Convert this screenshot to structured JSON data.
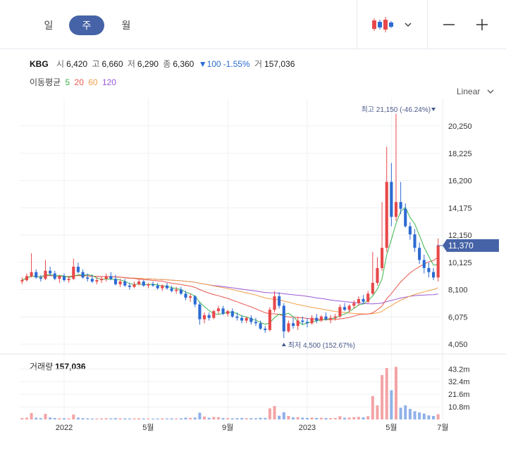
{
  "tabs": [
    {
      "label": "일",
      "active": false
    },
    {
      "label": "주",
      "active": true
    },
    {
      "label": "월",
      "active": false
    }
  ],
  "toolbar": {
    "chart_type_icon": "candlestick-icon",
    "zoom_out_icon": "minus-icon",
    "zoom_in_icon": "plus-icon"
  },
  "info": {
    "symbol": "KBG",
    "open_label": "시",
    "open": "6,420",
    "high_label": "고",
    "high": "6,660",
    "low_label": "저",
    "low": "6,290",
    "close_label": "종",
    "close": "6,360",
    "change": "▼100",
    "change_pct": "-1.55%",
    "volume_label": "거",
    "volume": "157,036"
  },
  "ma": {
    "label": "이동평균",
    "periods": [
      {
        "period": "5",
        "color": "#3cb44b"
      },
      {
        "period": "20",
        "color": "#e8584f"
      },
      {
        "period": "60",
        "color": "#f0a04b"
      },
      {
        "period": "120",
        "color": "#9b59d6"
      }
    ]
  },
  "scale": {
    "label": "Linear"
  },
  "colors": {
    "up": "#e8484a",
    "down": "#2c6bd3",
    "tab_active": "#4663a7",
    "grid": "#eef0f3",
    "last_price_bg": "#4663a7",
    "volume_up": "#f4a3a5",
    "volume_down": "#8fb1e9"
  },
  "chart_data": {
    "type": "candlestick",
    "x_labels": [
      "2022",
      "5월",
      "9월",
      "2023",
      "5월",
      "7월"
    ],
    "x_label_index": [
      9,
      27,
      44,
      61,
      79,
      90
    ],
    "y_ticks": [
      "20,250",
      "18,225",
      "16,200",
      "14,175",
      "12,150",
      "10,125",
      "8,100",
      "6,075",
      "4,050"
    ],
    "y_tick_values": [
      20250,
      18225,
      16200,
      14175,
      12150,
      10125,
      8100,
      6075,
      4050
    ],
    "ylim": [
      4050,
      21300
    ],
    "last_price": "11,370",
    "last_price_value": 11370,
    "high_annotation": "최고 21,150 (-46.24%)",
    "high_index": 88,
    "high_value": 21150,
    "low_annotation": "최저 4,500 (152.67%)",
    "low_index": 56,
    "low_value": 4500,
    "candles": [
      [
        8700,
        9000,
        8500,
        8800
      ],
      [
        8800,
        9300,
        8700,
        9100
      ],
      [
        9100,
        10800,
        9000,
        9400
      ],
      [
        9400,
        9600,
        8900,
        9000
      ],
      [
        9000,
        9200,
        8700,
        8900
      ],
      [
        8900,
        10300,
        8800,
        9500
      ],
      [
        9500,
        9800,
        9100,
        9300
      ],
      [
        9300,
        9500,
        8800,
        8900
      ],
      [
        8900,
        9200,
        8600,
        9100
      ],
      [
        9100,
        9300,
        8700,
        8800
      ],
      [
        8800,
        9100,
        8600,
        8900
      ],
      [
        8900,
        10400,
        8800,
        9800
      ],
      [
        9800,
        10100,
        9300,
        9400
      ],
      [
        9400,
        9600,
        8900,
        9000
      ],
      [
        9000,
        9300,
        8700,
        8900
      ],
      [
        8900,
        9200,
        8600,
        8700
      ],
      [
        8700,
        9000,
        8500,
        8800
      ],
      [
        8800,
        9100,
        8600,
        8900
      ],
      [
        8900,
        9300,
        8700,
        9100
      ],
      [
        9100,
        9400,
        8800,
        8900
      ],
      [
        8900,
        9200,
        8400,
        8500
      ],
      [
        8500,
        8900,
        8300,
        8700
      ],
      [
        8700,
        8900,
        8300,
        8400
      ],
      [
        8400,
        8600,
        8100,
        8300
      ],
      [
        8300,
        8700,
        8200,
        8500
      ],
      [
        8500,
        8900,
        8400,
        8700
      ],
      [
        8700,
        8800,
        8300,
        8400
      ],
      [
        8400,
        8600,
        8200,
        8500
      ],
      [
        8500,
        8700,
        8300,
        8400
      ],
      [
        8400,
        8600,
        8100,
        8200
      ],
      [
        8200,
        8500,
        8000,
        8400
      ],
      [
        8400,
        8600,
        8100,
        8200
      ],
      [
        8200,
        8400,
        7900,
        8000
      ],
      [
        8000,
        8300,
        7800,
        8100
      ],
      [
        8100,
        8300,
        7700,
        7800
      ],
      [
        7800,
        8000,
        7300,
        7500
      ],
      [
        7500,
        7800,
        7200,
        7600
      ],
      [
        7600,
        7700,
        6800,
        7000
      ],
      [
        7000,
        7200,
        5500,
        5900
      ],
      [
        5900,
        6400,
        5600,
        6200
      ],
      [
        6200,
        6400,
        5800,
        6000
      ],
      [
        6000,
        6600,
        5900,
        6500
      ],
      [
        6500,
        6900,
        6300,
        6700
      ],
      [
        6700,
        6900,
        6200,
        6300
      ],
      [
        6300,
        6600,
        6100,
        6500
      ],
      [
        6500,
        6700,
        6000,
        6100
      ],
      [
        6100,
        6400,
        5800,
        6000
      ],
      [
        6000,
        6200,
        5600,
        5800
      ],
      [
        5800,
        6100,
        5600,
        6000
      ],
      [
        6000,
        6200,
        5500,
        5700
      ],
      [
        5700,
        6000,
        5400,
        5600
      ],
      [
        5600,
        5800,
        5100,
        5200
      ],
      [
        5200,
        5400,
        4900,
        5100
      ],
      [
        5100,
        6800,
        5000,
        6600
      ],
      [
        6600,
        8000,
        6400,
        7600
      ],
      [
        7600,
        7900,
        6700,
        6900
      ],
      [
        6900,
        7100,
        4500,
        5000
      ],
      [
        5000,
        5800,
        4900,
        5600
      ],
      [
        5600,
        6000,
        5200,
        5400
      ],
      [
        5400,
        6100,
        5100,
        5800
      ],
      [
        5800,
        6100,
        5500,
        5700
      ],
      [
        5700,
        6000,
        5300,
        5600
      ],
      [
        5600,
        6200,
        5500,
        6000
      ],
      [
        6000,
        6300,
        5600,
        5800
      ],
      [
        5800,
        6200,
        5700,
        6100
      ],
      [
        6100,
        6400,
        5800,
        5900
      ],
      [
        5900,
        6200,
        5600,
        6000
      ],
      [
        6000,
        6300,
        5800,
        6100
      ],
      [
        6100,
        7000,
        6000,
        6800
      ],
      [
        6800,
        7100,
        6500,
        6600
      ],
      [
        6600,
        7000,
        6400,
        6900
      ],
      [
        6900,
        7300,
        6700,
        7100
      ],
      [
        7100,
        7600,
        6900,
        7400
      ],
      [
        7400,
        7700,
        7000,
        7200
      ],
      [
        7200,
        8000,
        7100,
        7800
      ],
      [
        7800,
        10900,
        7700,
        8600
      ],
      [
        8600,
        10500,
        8400,
        9700
      ],
      [
        9700,
        14600,
        9500,
        11200
      ],
      [
        11200,
        18700,
        10900,
        16100
      ],
      [
        16100,
        17500,
        12800,
        13500
      ],
      [
        13500,
        21150,
        13200,
        14600
      ],
      [
        14600,
        16100,
        13700,
        14100
      ],
      [
        14100,
        14500,
        12700,
        12800
      ],
      [
        12800,
        13100,
        11800,
        12200
      ],
      [
        12200,
        12600,
        10900,
        11200
      ],
      [
        11200,
        11600,
        10000,
        10300
      ],
      [
        10300,
        10700,
        9300,
        9700
      ],
      [
        9700,
        10100,
        9000,
        9400
      ],
      [
        9400,
        9700,
        8800,
        9000
      ],
      [
        9000,
        11900,
        8700,
        11370
      ]
    ],
    "volume": {
      "label": "거래량",
      "value": "157,036",
      "y_ticks": [
        "43.2m",
        "32.4m",
        "21.6m",
        "10.8m"
      ],
      "y_tick_values": [
        43.2,
        32.4,
        21.6,
        10.8
      ],
      "ylim": [
        0,
        50
      ],
      "values_m": [
        1.2,
        1.5,
        5.5,
        1.4,
        1.1,
        4.8,
        1.6,
        1.2,
        1.0,
        1.1,
        0.9,
        4.2,
        1.5,
        1.1,
        0.9,
        0.8,
        0.8,
        0.9,
        1.0,
        0.9,
        1.1,
        1.0,
        0.9,
        0.8,
        0.9,
        1.0,
        0.8,
        0.8,
        0.7,
        0.8,
        0.9,
        0.8,
        0.9,
        0.8,
        1.0,
        1.5,
        1.3,
        1.6,
        5.8,
        2.5,
        1.4,
        2.1,
        1.9,
        1.2,
        1.1,
        1.0,
        1.1,
        1.2,
        1.0,
        1.1,
        1.0,
        1.4,
        1.3,
        9.5,
        11.5,
        3.2,
        6.2,
        3.0,
        1.8,
        2.0,
        1.5,
        1.3,
        1.6,
        1.3,
        1.4,
        1.2,
        1.1,
        1.2,
        2.8,
        1.4,
        1.6,
        1.9,
        2.2,
        1.8,
        2.8,
        20.0,
        12.0,
        38.0,
        44.0,
        25.0,
        45.0,
        10.0,
        12.0,
        9.0,
        7.0,
        6.0,
        5.0,
        3.5,
        3.0,
        4.5
      ]
    }
  }
}
